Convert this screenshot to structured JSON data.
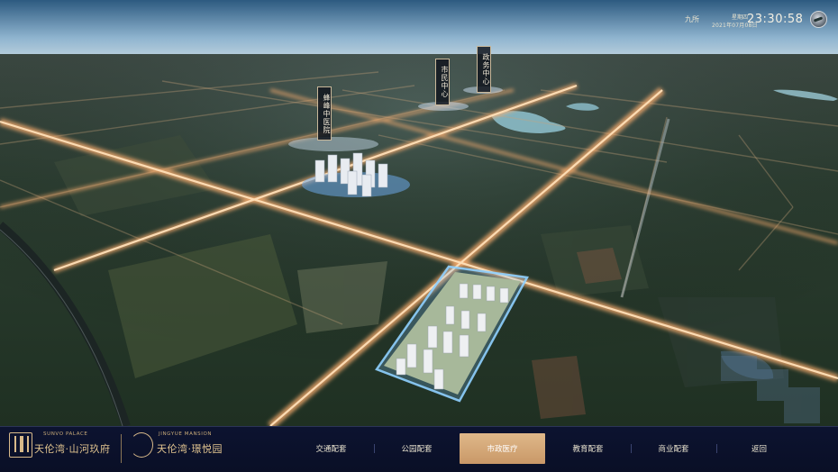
{
  "status": {
    "weather": "九所",
    "weekday": "星期四",
    "date": "2021年07月08日",
    "time": "23:30:58"
  },
  "pois": [
    {
      "label": "蜂峰中医院"
    },
    {
      "label": "市民中心"
    },
    {
      "label": "政务中心"
    }
  ],
  "brand": {
    "left_en": "SUNVO PALACE",
    "left_cn": "天伦湾·山河玖府",
    "right_en": "JINGYUE MANSION",
    "right_cn": "天伦湾·璟悦园"
  },
  "nav": {
    "items": [
      {
        "label": "交通配套",
        "active": false
      },
      {
        "label": "公园配套",
        "active": false
      },
      {
        "label": "市政医疗",
        "active": true
      },
      {
        "label": "教育配套",
        "active": false
      },
      {
        "label": "商业配套",
        "active": false
      },
      {
        "label": "返回",
        "active": false
      }
    ]
  },
  "colors": {
    "accent": "#d4a878",
    "bar_bg": "#0c1330",
    "road_glow": "#ffb070"
  }
}
